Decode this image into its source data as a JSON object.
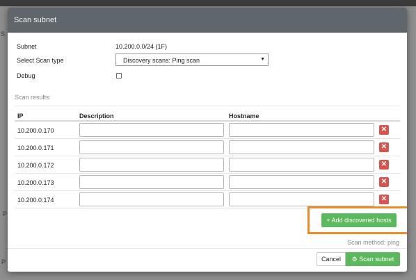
{
  "background": {
    "fragments": [
      "S",
      "P",
      "P"
    ]
  },
  "modal": {
    "title": "Scan subnet",
    "fields": {
      "subnet_label": "Subnet",
      "subnet_value": "10.200.0.0/24 (1F)",
      "scan_type_label": "Select Scan type",
      "scan_type_value": "Discovery scans: Ping scan",
      "debug_label": "Debug",
      "debug_checked": false
    },
    "scan_results_label": "Scan results:",
    "table": {
      "headers": [
        "IP",
        "Description",
        "Hostname"
      ],
      "rows": [
        {
          "ip": "10.200.0.170",
          "description": "",
          "hostname": ""
        },
        {
          "ip": "10.200.0.171",
          "description": "",
          "hostname": ""
        },
        {
          "ip": "10.200.0.172",
          "description": "",
          "hostname": ""
        },
        {
          "ip": "10.200.0.173",
          "description": "",
          "hostname": ""
        },
        {
          "ip": "10.200.0.174",
          "description": "",
          "hostname": ""
        }
      ]
    },
    "add_button_label": "Add discovered hosts",
    "scan_method": "Scan method: ping",
    "footer": {
      "cancel_label": "Cancel",
      "scan_label": "Scan subnet"
    }
  },
  "icons": {
    "delete": "times-icon",
    "add": "plus-icon",
    "scan": "gears-icon",
    "select_arrow": "caret-down-icon"
  },
  "colors": {
    "header_bg": "#5f666c",
    "success": "#5cb85c",
    "danger": "#d9534f",
    "highlight": "#f08a24"
  }
}
